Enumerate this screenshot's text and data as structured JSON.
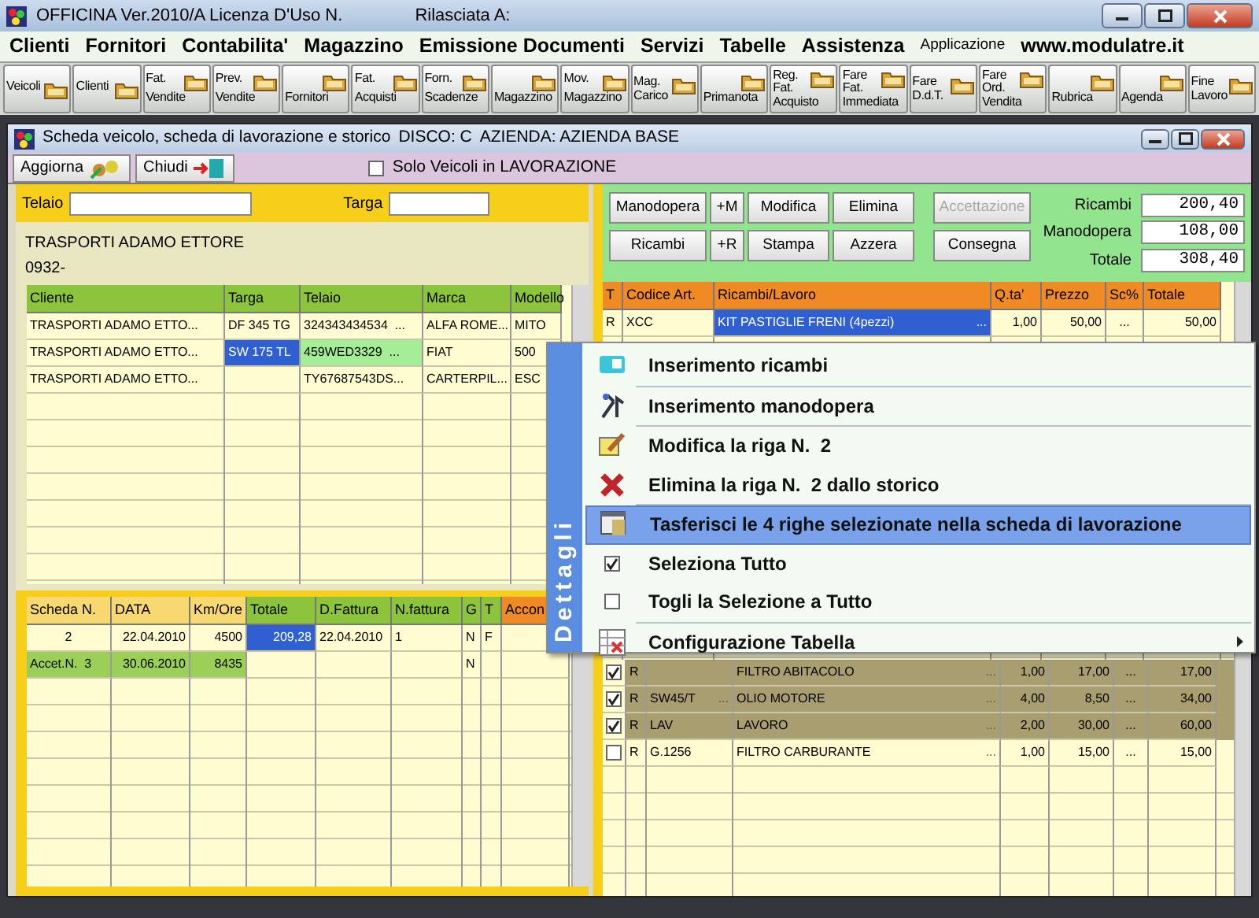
{
  "window": {
    "title": "OFFICINA Ver.2010/A  Licenza D'Uso N.",
    "licensee_label": "Rilasciata A:"
  },
  "menu_bar": {
    "items": [
      "Clienti",
      "Fornitori",
      "Contabilita'",
      "Magazzino",
      "Emissione Documenti",
      "Servizi",
      "Tabelle",
      "Assistenza"
    ],
    "app_label": "Applicazione",
    "website": "www.modulatre.it"
  },
  "toolbar": [
    {
      "lines": [
        "Veicoli"
      ]
    },
    {
      "lines": [
        "Clienti"
      ]
    },
    {
      "lines": [
        "Fat.",
        "Vendite"
      ]
    },
    {
      "lines": [
        "Prev.",
        "Vendite"
      ]
    },
    {
      "lines": [
        "Fornitori"
      ]
    },
    {
      "lines": [
        "Fat.",
        "Acquisti"
      ]
    },
    {
      "lines": [
        "Forn.",
        "Scadenze"
      ]
    },
    {
      "lines": [
        "Magazzino"
      ]
    },
    {
      "lines": [
        "Mov.",
        "Magazzino"
      ]
    },
    {
      "lines": [
        "Mag.",
        "Carico"
      ]
    },
    {
      "lines": [
        "Primanota"
      ]
    },
    {
      "lines": [
        "Reg.",
        "Fat.",
        "Acquisto"
      ]
    },
    {
      "lines": [
        "Fare",
        "Fat.",
        "Immediata"
      ]
    },
    {
      "lines": [
        "Fare",
        "D.d.T."
      ]
    },
    {
      "lines": [
        "Fare",
        "Ord.",
        "Vendita"
      ]
    },
    {
      "lines": [
        "Rubrica"
      ]
    },
    {
      "lines": [
        "Agenda"
      ]
    },
    {
      "lines": [
        "Fine",
        "Lavoro"
      ]
    }
  ],
  "child_window": {
    "title": "Scheda veicolo, scheda di lavorazione e storico",
    "disk": "DISCO: C",
    "company": "AZIENDA: AZIENDA BASE"
  },
  "actions": [
    {
      "label": "Aggiorna",
      "kind": "refresh"
    },
    {
      "label": "Chiudi",
      "kind": "exit"
    }
  ],
  "filter": {
    "label": "Solo Veicoli in LAVORAZIONE",
    "checked": false
  },
  "search_fields": [
    {
      "label": "Telaio"
    },
    {
      "label": "Targa"
    }
  ],
  "customer": {
    "name": "TRASPORTI ADAMO ETTORE",
    "phone": "0932-"
  },
  "vehicles": {
    "columns": [
      "Cliente",
      "Targa",
      "Telaio",
      "Marca",
      "Modello"
    ],
    "rows": [
      {
        "cells": [
          "TRASPORTI ADAMO ETTO...",
          "DF 345 TG",
          "324343434534  ...",
          "ALFA ROME...",
          "MITO"
        ],
        "selected": false
      },
      {
        "cells": [
          "TRASPORTI ADAMO ETTO...",
          "SW 175 TL",
          "459WED3329  ...",
          "FIAT",
          "500"
        ],
        "selected": true
      },
      {
        "cells": [
          "TRASPORTI ADAMO ETTO...",
          null,
          "TY67687543DS...",
          "CARTERPIL...",
          "ESC"
        ],
        "selected": false
      }
    ]
  },
  "history": {
    "columns": [
      {
        "label": "Scheda N.",
        "color": "#f8d870"
      },
      {
        "label": "DATA",
        "color": "#f8d870"
      },
      {
        "label": "Km/Ore",
        "color": "#f8d870"
      },
      {
        "label": "Totale",
        "color": "#8cc43c"
      },
      {
        "label": "D.Fattura",
        "color": "#8cc43c"
      },
      {
        "label": "N.fattura",
        "color": "#8cc43c"
      },
      {
        "label": "G",
        "color": "#8cc43c"
      },
      {
        "label": "T",
        "color": "#8cc43c"
      },
      {
        "label": "Accon",
        "color": "#f08a24"
      }
    ],
    "rows": [
      {
        "kind": "invoice",
        "selected": true,
        "cells": [
          "2",
          "22.04.2010",
          "4500",
          "209,28",
          "22.04.2010",
          "1",
          "N",
          "F",
          null
        ]
      },
      {
        "kind": "acceptance",
        "selected": false,
        "cells": [
          "Accet.N.  3",
          "30.06.2010",
          "8435",
          null,
          null,
          null,
          "N",
          null,
          null
        ]
      }
    ]
  },
  "work": {
    "buttons": [
      {
        "label": "Manodopera",
        "disabled": false
      },
      {
        "label": "+M",
        "disabled": false
      },
      {
        "label": "Modifica",
        "disabled": false
      },
      {
        "label": "Elimina",
        "disabled": false
      },
      {
        "label": "Accettazione",
        "disabled": true
      },
      {
        "label": "Ricambi",
        "disabled": false
      },
      {
        "label": "+R",
        "disabled": false
      },
      {
        "label": "Stampa",
        "disabled": false
      },
      {
        "label": "Azzera",
        "disabled": false
      },
      {
        "label": "Consegna",
        "disabled": false
      }
    ],
    "totals": [
      {
        "label": "Ricambi",
        "value": "200,40"
      },
      {
        "label": "Manodopera",
        "value": "108,00"
      },
      {
        "label": "Totale",
        "value": "308,40"
      }
    ]
  },
  "lines": {
    "columns": [
      "T",
      "Codice Art.",
      "Ricambi/Lavoro",
      "Q.ta'",
      "Prezzo",
      "Sc%",
      "Totale"
    ],
    "rows": [
      {
        "type": "R",
        "code": "XCC",
        "description": "KIT PASTIGLIE FRENI (4pezzi)",
        "description_more": "...",
        "qty": "1,00",
        "price": "50,00",
        "discount": "...",
        "total": "50,00",
        "selected": true
      }
    ]
  },
  "history_lines": [
    {
      "checked": true,
      "type": "R",
      "description": "FILTRO ABITACOLO",
      "description_more": "...",
      "qty": "1,00",
      "price": "17,00",
      "discount": "...",
      "total": "17,00"
    },
    {
      "checked": true,
      "type": "R",
      "code": "SW45/T",
      "code_more": "...",
      "description": "OLIO MOTORE",
      "description_more": "...",
      "qty": "4,00",
      "price": "8,50",
      "discount": "...",
      "total": "34,00"
    },
    {
      "checked": true,
      "type": "R",
      "code": "LAV",
      "description": "LAVORO",
      "description_more": "...",
      "qty": "2,00",
      "price": "30,00",
      "discount": "...",
      "total": "60,00"
    },
    {
      "checked": false,
      "type": "R",
      "code": "G.1256",
      "description": "FILTRO CARBURANTE",
      "description_more": "...",
      "qty": "1,00",
      "price": "15,00",
      "discount": "...",
      "total": "15,00"
    }
  ],
  "context_menu": {
    "title": "Dettagli",
    "items": [
      {
        "kind": "parts",
        "label": "Inserimento ricambi",
        "selected": false,
        "divider": true
      },
      {
        "kind": "tools",
        "label": "Inserimento manodopera",
        "selected": false,
        "divider": true
      },
      {
        "kind": "edit",
        "label": "Modifica la riga N.  2",
        "selected": false,
        "divider": false
      },
      {
        "kind": "delete",
        "label": "Elimina la riga N.  2 dallo storico",
        "selected": false,
        "divider": true
      },
      {
        "kind": "transfer",
        "label": "Tasferisci le 4 righe selezionate nella scheda di lavorazione",
        "selected": true,
        "divider": false
      },
      {
        "kind": "check",
        "label": "Seleziona Tutto",
        "checked": true,
        "selected": false,
        "divider": false
      },
      {
        "kind": "check",
        "label": "Togli la Selezione a Tutto",
        "checked": false,
        "selected": false,
        "divider": true
      },
      {
        "kind": "config",
        "label": "Configurazione Tabella",
        "selected": false,
        "divider": false,
        "submenu": true
      }
    ]
  }
}
